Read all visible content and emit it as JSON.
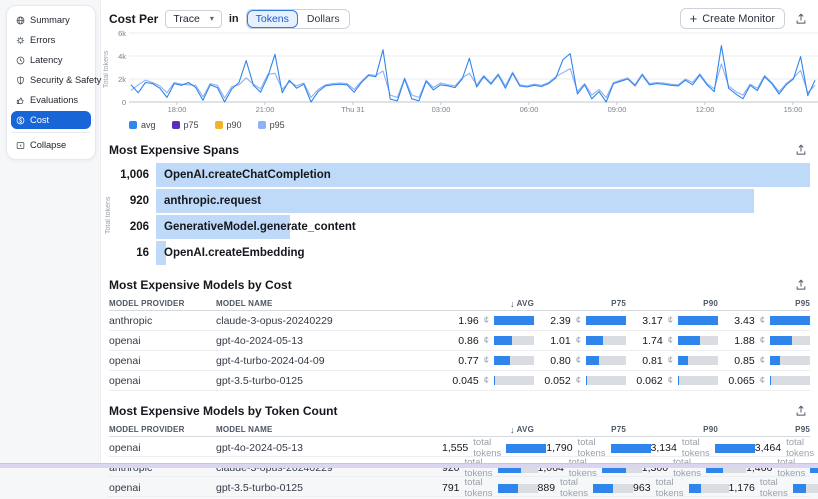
{
  "sidebar": {
    "items": [
      {
        "label": "Summary",
        "icon": "globe-icon",
        "active": false
      },
      {
        "label": "Errors",
        "icon": "errors-icon",
        "active": false
      },
      {
        "label": "Latency",
        "icon": "clock-icon",
        "active": false
      },
      {
        "label": "Security & Safety",
        "icon": "shield-icon",
        "active": false
      },
      {
        "label": "Evaluations",
        "icon": "thumbs-icon",
        "active": false
      },
      {
        "label": "Cost",
        "icon": "dollar-icon",
        "active": true
      }
    ],
    "collapse_label": "Collapse",
    "active_color": "#1865d8"
  },
  "toolbar": {
    "cost_per_label": "Cost Per",
    "trace_dropdown_value": "Trace",
    "in_label": "in",
    "unit_tokens": "Tokens",
    "unit_dollars": "Dollars",
    "active_unit": "Tokens",
    "create_monitor_label": "Create Monitor"
  },
  "chart_data": [
    {
      "type": "line",
      "title": "Cost Per Trace in Tokens",
      "ylabel": "Total tokens",
      "x_ticks": [
        "18:00",
        "21:00",
        "Thu 31",
        "03:00",
        "06:00",
        "09:00",
        "12:00",
        "15:00"
      ],
      "y_ticks": [
        "0",
        "2k",
        "4k",
        "6k"
      ],
      "ylim": [
        0,
        6000
      ],
      "grid": true,
      "legend_position": "bottom",
      "series": [
        {
          "name": "avg",
          "color": "#2f86ec",
          "values": [
            1500,
            800,
            1700,
            1600,
            1200,
            400,
            1600,
            1450,
            1700,
            1250,
            150,
            1500,
            1250,
            0,
            1150,
            1700,
            3600,
            1450,
            850,
            2200,
            4150,
            800,
            1900,
            1200,
            1550,
            0,
            900,
            1400,
            1500,
            1550,
            1500,
            850,
            1700,
            2300,
            2200,
            4550,
            250,
            100,
            2000,
            280,
            100,
            1800,
            1050,
            1500,
            1400,
            1250,
            2000,
            3800,
            1300,
            2200,
            1550,
            2350,
            1200,
            2500,
            1400,
            1300,
            1450,
            1350,
            1600,
            2100,
            3700,
            4200,
            700,
            1500,
            280,
            900,
            0,
            1600,
            1800,
            2000,
            1400,
            2350,
            1500,
            1600,
            1550,
            1450,
            1400,
            1900,
            1500,
            2350,
            1500,
            900,
            4900,
            1200,
            700,
            280,
            1450,
            1000,
            2200,
            1600,
            700,
            1500,
            2000,
            3950,
            550,
            1900
          ]
        },
        {
          "name": "p75",
          "color": "#5b2ebe",
          "values": []
        },
        {
          "name": "p90",
          "color": "#f0b429",
          "values": []
        },
        {
          "name": "p95",
          "color": "#8fb0f3",
          "values": [
            1000,
            1500,
            1900,
            1700,
            1400,
            800,
            1700,
            1550,
            1500,
            1450,
            450,
            1600,
            1450,
            350,
            1350,
            1500,
            2100,
            1550,
            1150,
            2400,
            2500,
            1100,
            1750,
            1400,
            1650,
            400,
            1100,
            1500,
            1600,
            1650,
            1600,
            1100,
            1800,
            2400,
            2300,
            2700,
            600,
            400,
            2100,
            600,
            400,
            1900,
            1250,
            1650,
            1500,
            1400,
            2100,
            2500,
            1500,
            2300,
            1650,
            2450,
            1400,
            2600,
            1500,
            1400,
            1550,
            1450,
            1700,
            2200,
            2550,
            2900,
            900,
            1600,
            600,
            1100,
            380,
            1700,
            1900,
            2100,
            1500,
            2450,
            1600,
            1700,
            1650,
            1550,
            1500,
            2000,
            1700,
            2450,
            1600,
            1150,
            3300,
            1400,
            900,
            600,
            1550,
            1200,
            2300,
            1700,
            900,
            1600,
            2100,
            2750,
            800,
            1450
          ]
        }
      ]
    },
    {
      "type": "bar",
      "orientation": "horizontal",
      "title": "Most Expensive Spans",
      "ylabel": "Total tokens",
      "bar_color": "#bfd9f8",
      "categories": [
        "OpenAI.createChatCompletion",
        "anthropic.request",
        "GenerativeModel.generate_content",
        "OpenAI.createEmbedding"
      ],
      "values": [
        1006,
        920,
        206,
        16
      ],
      "value_labels": [
        "1,006",
        "920",
        "206",
        "16"
      ]
    },
    {
      "type": "table",
      "title": "Most Expensive Models by Cost",
      "unit": "¢",
      "sort_column": "AVG",
      "bar_fill_color": "#3085ec",
      "bar_track_color": "#d9dde2",
      "columns": [
        "MODEL PROVIDER",
        "MODEL NAME",
        "AVG",
        "P75",
        "P90",
        "P95"
      ],
      "rows": [
        {
          "provider": "anthropic",
          "name": "claude-3-opus-20240229",
          "values": [
            "1.96",
            "2.39",
            "3.17",
            "3.43"
          ]
        },
        {
          "provider": "openai",
          "name": "gpt-4o-2024-05-13",
          "values": [
            "0.86",
            "1.01",
            "1.74",
            "1.88"
          ]
        },
        {
          "provider": "openai",
          "name": "gpt-4-turbo-2024-04-09",
          "values": [
            "0.77",
            "0.80",
            "0.81",
            "0.85"
          ]
        },
        {
          "provider": "openai",
          "name": "gpt-3.5-turbo-0125",
          "values": [
            "0.045",
            "0.052",
            "0.062",
            "0.065"
          ]
        }
      ]
    },
    {
      "type": "table",
      "title": "Most Expensive Models by Token Count",
      "unit": "total tokens",
      "sort_column": "AVG",
      "bar_fill_color": "#3085ec",
      "bar_track_color": "#d9dde2",
      "columns": [
        "MODEL PROVIDER",
        "MODEL NAME",
        "AVG",
        "P75",
        "P90",
        "P95"
      ],
      "rows": [
        {
          "provider": "openai",
          "name": "gpt-4o-2024-05-13",
          "values": [
            "1,555",
            "1,790",
            "3,134",
            "3,464"
          ]
        },
        {
          "provider": "anthropic",
          "name": "claude-3-opus-20240229",
          "values": [
            "920",
            "1,064",
            "1,300",
            "1,466"
          ]
        },
        {
          "provider": "openai",
          "name": "gpt-3.5-turbo-0125",
          "values": [
            "791",
            "889",
            "963",
            "1,176"
          ]
        }
      ]
    }
  ]
}
